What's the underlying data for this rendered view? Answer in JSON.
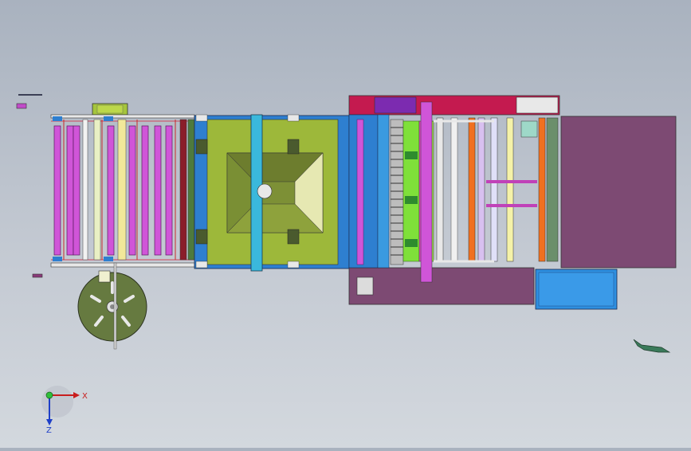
{
  "triad": {
    "x_label": "X",
    "z_label": "Z"
  },
  "palette": {
    "frame": "#2a2f3a",
    "magenta_roller": "#d055d8",
    "yellow_green": "#a8c33a",
    "olive": "#6b7f32",
    "blue": "#2e7fd0",
    "purple": "#7d4a73",
    "crimson": "#c41a4f",
    "cyan": "#38b8e0",
    "green": "#7fe03a",
    "orange": "#f07020"
  }
}
